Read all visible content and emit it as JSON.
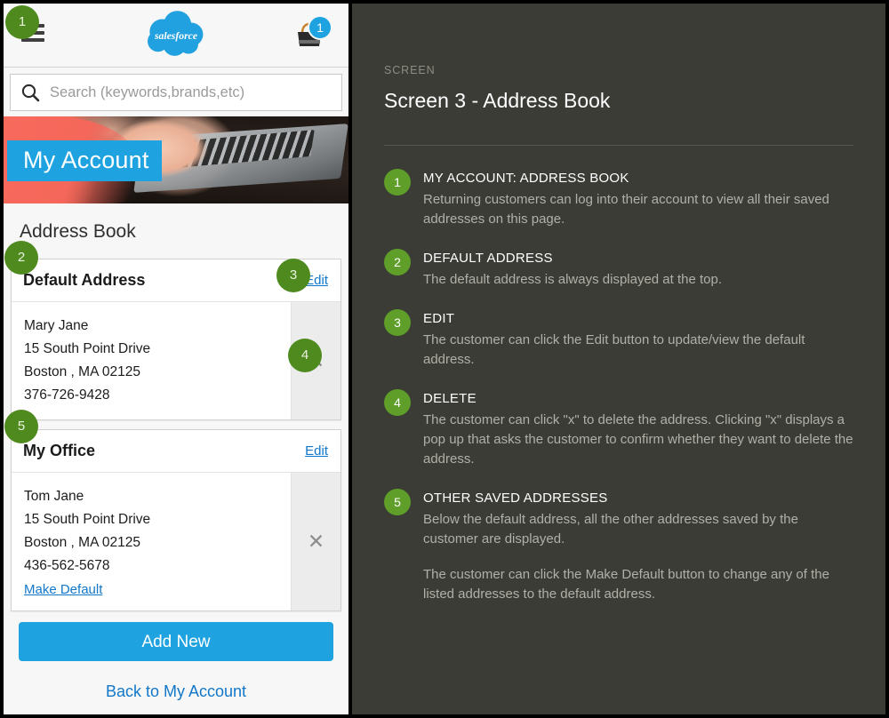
{
  "phone": {
    "header": {
      "menu_icon": "hamburger-menu-icon",
      "logo_text": "salesforce",
      "bag_icon": "shopping-bag-icon",
      "bag_count": "1"
    },
    "search": {
      "icon": "search-icon",
      "value": "",
      "placeholder": "Search (keywords,brands,etc)"
    },
    "hero": {
      "tag": "My Account",
      "image_alt": "hands-typing-on-laptop-photo"
    },
    "page_title": "Address Book",
    "addresses": [
      {
        "title": "Default Address",
        "edit_label": "Edit",
        "lines": [
          "Mary Jane",
          "15 South Point Drive",
          "Boston , MA 02125",
          "376-726-9428"
        ],
        "make_default_label": "",
        "delete_icon": "close-x-icon"
      },
      {
        "title": "My Office",
        "edit_label": "Edit",
        "lines": [
          "Tom Jane",
          "15 South Point Drive",
          "Boston , MA 02125",
          "436-562-5678"
        ],
        "make_default_label": "Make Default",
        "delete_icon": "close-x-icon"
      }
    ],
    "add_new_label": "Add New",
    "back_link_label": "Back to My Account"
  },
  "notes": {
    "kicker": "SCREEN",
    "title": "Screen 3 - Address Book",
    "items": [
      {
        "num": "1",
        "head": "MY ACCOUNT: ADDRESS BOOK",
        "text": "Returning customers can log into their account to view all their saved addresses on this page.",
        "text2": ""
      },
      {
        "num": "2",
        "head": "DEFAULT ADDRESS",
        "text": "The default address is always displayed at the top.",
        "text2": ""
      },
      {
        "num": "3",
        "head": "EDIT",
        "text": "The customer can click the Edit button to update/view the default address.",
        "text2": ""
      },
      {
        "num": "4",
        "head": "DELETE",
        "text": "The customer can click \"x\" to delete the address. Clicking \"x\" displays a pop up that asks the customer to confirm whether they want to delete the address.",
        "text2": ""
      },
      {
        "num": "5",
        "head": "OTHER SAVED ADDRESSES",
        "text": "Below the default address, all the other addresses saved by the customer are displayed.",
        "text2": "The customer can click the Make Default button to change any of the listed addresses to the default address."
      }
    ]
  },
  "callouts": [
    {
      "num": "1"
    },
    {
      "num": "2"
    },
    {
      "num": "3"
    },
    {
      "num": "4"
    },
    {
      "num": "5"
    }
  ],
  "colors": {
    "brand_blue": "#1fa3e0",
    "link_blue": "#1277c9",
    "callout_green": "#4f8a1e",
    "note_green": "#5e9e29",
    "panel_bg": "#3c3c36"
  }
}
